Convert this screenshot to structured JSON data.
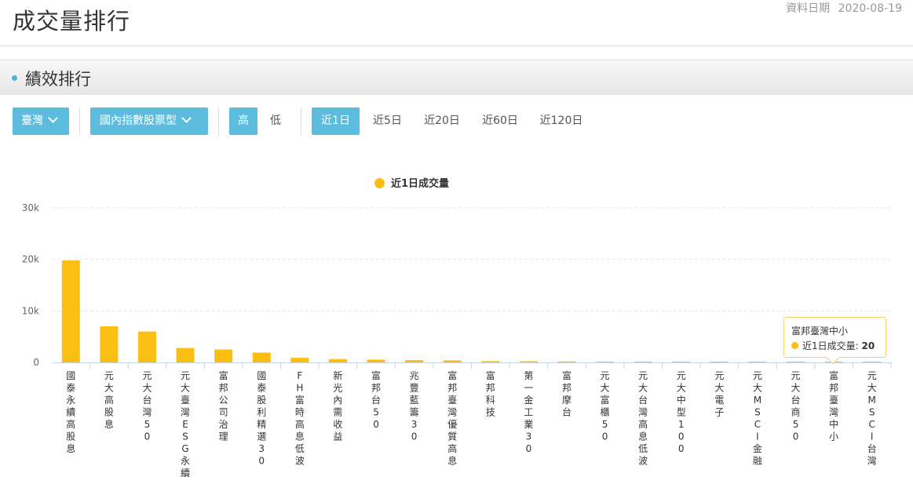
{
  "header": {
    "title": "成交量排行",
    "date_label": "資料日期",
    "date": "2020-08-19"
  },
  "section": {
    "title": "績效排行"
  },
  "filters": {
    "region": "臺灣",
    "type": "國內指數股票型",
    "order_high": "高",
    "order_low": "低",
    "periods": [
      "近1日",
      "近5日",
      "近20日",
      "近60日",
      "近120日"
    ]
  },
  "colors": {
    "accent": "#5bbcdd",
    "bar": "#fbbf14"
  },
  "tooltip": {
    "title": "富邦臺灣中小",
    "series": "近1日成交量",
    "value": "20"
  },
  "chart_data": {
    "type": "bar",
    "categories": [
      "國泰永續高股息",
      "元大高股息",
      "元大台灣50",
      "元大臺灣ESG永續",
      "富邦公司治理",
      "國泰股利精選30",
      "FH富時高息低波",
      "新光內需收益",
      "富邦台50",
      "兆豐藍籌30",
      "富邦臺灣優質高息",
      "富邦科技",
      "第一金工業30",
      "富邦摩台",
      "元大富櫃50",
      "元大台灣高息低波",
      "元大中型100",
      "元大電子",
      "元大MSCI金融",
      "元大台商50",
      "富邦臺灣中小",
      "元大MSCI台灣"
    ],
    "series": [
      {
        "name": "近1日成交量",
        "values": [
          19800,
          7000,
          6000,
          2800,
          2500,
          1900,
          900,
          650,
          550,
          450,
          400,
          250,
          230,
          200,
          120,
          110,
          90,
          70,
          60,
          50,
          20,
          15
        ]
      }
    ],
    "ylim": [
      0,
      30000
    ],
    "yticks": [
      "0",
      "10k",
      "20k",
      "30k"
    ],
    "grid": true,
    "legend": "top-center"
  }
}
